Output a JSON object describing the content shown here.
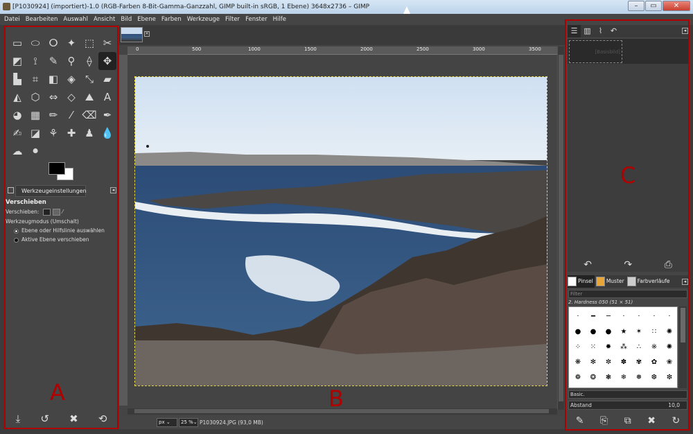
{
  "window": {
    "title": "[P1030924] (importiert)-1.0 (RGB-Farben 8-Bit-Gamma-Ganzzahl, GIMP built-in sRGB, 1 Ebene) 3648x2736 – GIMP",
    "min": "–",
    "max": "▭",
    "close": "✕"
  },
  "menu": [
    "Datei",
    "Bearbeiten",
    "Auswahl",
    "Ansicht",
    "Bild",
    "Ebene",
    "Farben",
    "Werkzeuge",
    "Filter",
    "Fenster",
    "Hilfe"
  ],
  "toolbox": {
    "tools": [
      {
        "name": "rect-select-icon",
        "glyph": "▭"
      },
      {
        "name": "ellipse-select-icon",
        "glyph": "⬭"
      },
      {
        "name": "free-select-icon",
        "glyph": "ⵔ"
      },
      {
        "name": "fuzzy-select-icon",
        "glyph": "✦"
      },
      {
        "name": "color-select-icon",
        "glyph": "⬚"
      },
      {
        "name": "scissors-icon",
        "glyph": "✂"
      },
      {
        "name": "foreground-select-icon",
        "glyph": "◩"
      },
      {
        "name": "paths-icon",
        "glyph": "⟟"
      },
      {
        "name": "color-picker-icon",
        "glyph": "✎"
      },
      {
        "name": "zoom-icon",
        "glyph": "⚲"
      },
      {
        "name": "measure-icon",
        "glyph": "⟠"
      },
      {
        "name": "move-icon",
        "glyph": "✥"
      },
      {
        "name": "align-icon",
        "glyph": "▙"
      },
      {
        "name": "crop-icon",
        "glyph": "⌗"
      },
      {
        "name": "unified-transform-icon",
        "glyph": "◧"
      },
      {
        "name": "rotate-icon",
        "glyph": "◈"
      },
      {
        "name": "scale-icon",
        "glyph": "⤡"
      },
      {
        "name": "shear-icon",
        "glyph": "▰"
      },
      {
        "name": "flip-icon",
        "glyph": "◭"
      },
      {
        "name": "perspective-icon",
        "glyph": "⬡"
      },
      {
        "name": "flip-horizontal-icon",
        "glyph": "⇔"
      },
      {
        "name": "cage-icon",
        "glyph": "◇"
      },
      {
        "name": "warp-icon",
        "glyph": "⛰"
      },
      {
        "name": "text-icon",
        "glyph": "A"
      },
      {
        "name": "bucket-fill-icon",
        "glyph": "◕"
      },
      {
        "name": "blend-icon",
        "glyph": "▦"
      },
      {
        "name": "pencil-icon",
        "glyph": "✏"
      },
      {
        "name": "paintbrush-icon",
        "glyph": "⁄"
      },
      {
        "name": "eraser-icon",
        "glyph": "⌫"
      },
      {
        "name": "airbrush-icon",
        "glyph": "✒"
      },
      {
        "name": "ink-icon",
        "glyph": "✍"
      },
      {
        "name": "mypaint-brush-icon",
        "glyph": "◪"
      },
      {
        "name": "clone-icon",
        "glyph": "⚘"
      },
      {
        "name": "heal-icon",
        "glyph": "✚"
      },
      {
        "name": "perspective-clone-icon",
        "glyph": "♟"
      },
      {
        "name": "blur-icon",
        "glyph": "💧"
      },
      {
        "name": "smudge-icon",
        "glyph": "☁"
      },
      {
        "name": "dodge-burn-icon",
        "glyph": "⚫"
      }
    ],
    "selected_index": 11,
    "colors": {
      "foreground": "#000000",
      "background": "#ffffff"
    }
  },
  "tool_options": {
    "tab_label": "Werkzeugeinstellungen",
    "heading": "Verschieben",
    "move_label": "Verschieben:",
    "mode_label": "Werkzeugmodus (Umschalt)",
    "option1": "Ebene oder Hilfslinie auswählen",
    "option2": "Aktive Ebene verschieben",
    "bottom_icons": [
      "save-options-icon",
      "restore-options-icon",
      "delete-options-icon",
      "reset-options-icon"
    ],
    "bottom_glyphs": [
      "⤓",
      "↺",
      "✖",
      "⟲"
    ]
  },
  "canvas": {
    "ruler_marks": [
      "0",
      "500",
      "1000",
      "1500",
      "2000",
      "2500",
      "3000",
      "3500"
    ],
    "unit": "px",
    "zoom": "25 %",
    "status": "P1030924.JPG (93,0 MB)"
  },
  "annotations": {
    "a": "A",
    "b": "B",
    "c": "C"
  },
  "layers": {
    "tabs": [
      "layers-icon",
      "channels-icon",
      "paths-tab-icon",
      "undo-history-icon"
    ],
    "tab_glyphs": [
      "☰",
      "▥",
      "⌇",
      "↶"
    ],
    "layer_name": "[Basisbild]",
    "undo_glyph": "↶",
    "redo_glyph": "↷",
    "print_glyph": "⎙"
  },
  "brushes": {
    "tabs": [
      {
        "label": "Pinsel",
        "color": "#ffffff"
      },
      {
        "label": "Muster",
        "color": "#e8a53a"
      },
      {
        "label": "Farbverläufe",
        "color": "#cccccc"
      }
    ],
    "filter_placeholder": "Filter",
    "current": "2. Hardness 050 (51 × 51)",
    "brush_glyphs": [
      "·",
      "━",
      "─",
      "·",
      "·",
      "·",
      "·",
      "●",
      "●",
      "●",
      "★",
      "✶",
      "∷",
      "✺",
      "⁘",
      "⁙",
      "✹",
      "⁂",
      "∴",
      "※",
      "✺",
      "❋",
      "✻",
      "✼",
      "✽",
      "✾",
      "✿",
      "❀",
      "❁",
      "❂",
      "❃",
      "❄",
      "❅",
      "❆",
      "❇"
    ],
    "set": "Basic.",
    "spacing_label": "Abstand",
    "spacing_value": "10,0",
    "bottom_glyphs": [
      "✎",
      "⎘",
      "⧉",
      "✖",
      "↻"
    ]
  }
}
